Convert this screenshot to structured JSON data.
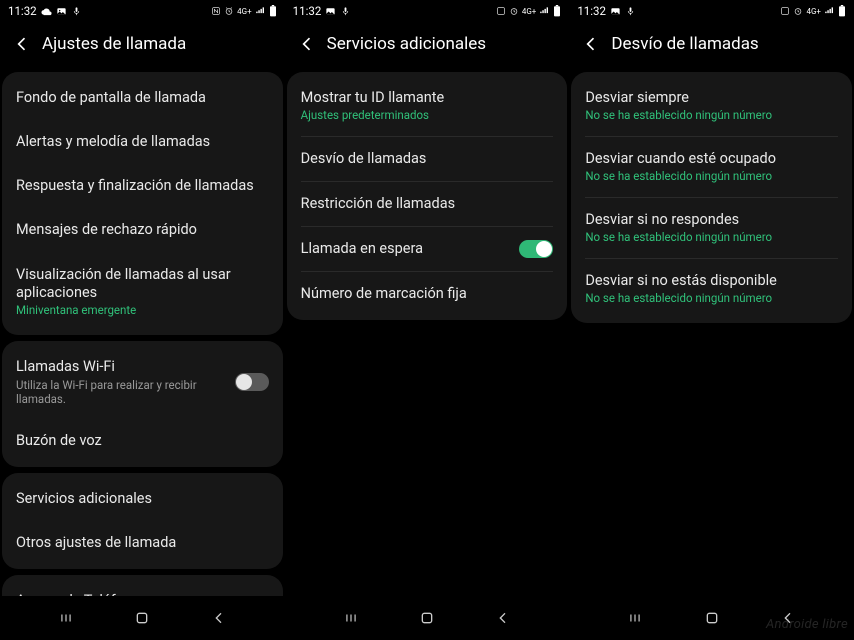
{
  "status": {
    "time": "11:32",
    "left_icons": [
      "picture-icon",
      "mic-icon"
    ],
    "right_icons": [
      "alarm-icon",
      "alarm2-icon",
      "wifi-icon",
      "signal-icon",
      "battery-icon"
    ]
  },
  "screen1": {
    "title": "Ajustes de llamada",
    "group1": [
      {
        "label": "Fondo de pantalla de llamada"
      },
      {
        "label": "Alertas y melodía de llamadas"
      },
      {
        "label": "Respuesta y finalización de llamadas"
      },
      {
        "label": "Mensajes de rechazo rápido"
      },
      {
        "label": "Visualización de llamadas al usar aplicaciones",
        "sub": "Miniventana emergente"
      }
    ],
    "group2": [
      {
        "label": "Llamadas Wi-Fi",
        "subgray": "Utiliza la Wi-Fi para realizar y recibir llamadas.",
        "toggle": false
      },
      {
        "label": "Buzón de voz"
      }
    ],
    "group3": [
      {
        "label": "Servicios adicionales"
      },
      {
        "label": "Otros ajustes de llamada"
      }
    ],
    "group4": [
      {
        "label": "Acerca de Teléfono"
      }
    ]
  },
  "screen2": {
    "title": "Servicios adicionales",
    "rows": [
      {
        "label": "Mostrar tu ID llamante",
        "sub": "Ajustes predeterminados"
      },
      {
        "label": "Desvío de llamadas"
      },
      {
        "label": "Restricción de llamadas"
      },
      {
        "label": "Llamada en espera",
        "toggle": true
      },
      {
        "label": "Número de marcación fija"
      }
    ]
  },
  "screen3": {
    "title": "Desvío de llamadas",
    "rows": [
      {
        "label": "Desviar siempre",
        "sub": "No se ha establecido ningún número"
      },
      {
        "label": "Desviar cuando esté ocupado",
        "sub": "No se ha establecido ningún número"
      },
      {
        "label": "Desviar si no respondes",
        "sub": "No se ha establecido ningún número"
      },
      {
        "label": "Desviar si no estás disponible",
        "sub": "No se ha establecido ningún número"
      }
    ]
  },
  "watermark": "Androide libre"
}
